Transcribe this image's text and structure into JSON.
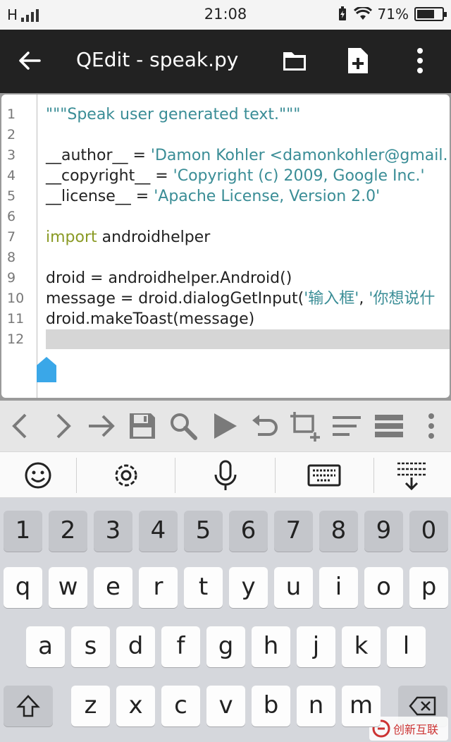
{
  "status": {
    "carrier": "H",
    "time": "21:08",
    "battery": "71%",
    "battery_level": 0.71
  },
  "appbar": {
    "title": "QEdit - speak.py",
    "icons": [
      "back-arrow-icon",
      "folder-icon",
      "new-file-icon",
      "overflow-menu-icon"
    ]
  },
  "editor": {
    "lines": [
      {
        "n": "1",
        "parts": [
          {
            "t": "\"\"\"Speak user generated text.\"\"\"",
            "c": "str"
          }
        ]
      },
      {
        "n": "2",
        "parts": []
      },
      {
        "n": "3",
        "parts": [
          {
            "t": "__author__ = ",
            "c": ""
          },
          {
            "t": "'Damon Kohler <damonkohler@gmail.",
            "c": "str"
          }
        ]
      },
      {
        "n": "4",
        "parts": [
          {
            "t": "__copyright__ = ",
            "c": ""
          },
          {
            "t": "'Copyright (c) 2009, Google Inc.'",
            "c": "str"
          }
        ]
      },
      {
        "n": "5",
        "parts": [
          {
            "t": "__license__ = ",
            "c": ""
          },
          {
            "t": "'Apache License, Version 2.0'",
            "c": "str"
          }
        ]
      },
      {
        "n": "6",
        "parts": []
      },
      {
        "n": "7",
        "parts": [
          {
            "t": "import",
            "c": "kw"
          },
          {
            "t": " androidhelper",
            "c": ""
          }
        ]
      },
      {
        "n": "8",
        "parts": []
      },
      {
        "n": "9",
        "parts": [
          {
            "t": "droid = androidhelper.Android()",
            "c": ""
          }
        ]
      },
      {
        "n": "10",
        "parts": [
          {
            "t": "message = droid.dialogGetInput(",
            "c": ""
          },
          {
            "t": "'输入框'",
            "c": "str"
          },
          {
            "t": ", ",
            "c": ""
          },
          {
            "t": "'你想说什",
            "c": "str"
          }
        ]
      },
      {
        "n": "11",
        "parts": [
          {
            "t": "droid.makeToast(message)",
            "c": ""
          }
        ]
      },
      {
        "n": "12",
        "parts": []
      }
    ],
    "current_line": "12"
  },
  "toolbar": {
    "icons": [
      "chevron-left-icon",
      "chevron-right-icon",
      "arrow-right-icon",
      "save-icon",
      "search-icon",
      "run-icon",
      "undo-icon",
      "add-snippet-icon",
      "format-icon",
      "list-icon",
      "more-icon"
    ]
  },
  "keyboard_top": {
    "icons": [
      "emoji-icon",
      "settings-icon",
      "microphone-icon",
      "keyboard-icon",
      "hide-keyboard-icon"
    ]
  },
  "keyboard": {
    "row_numbers": [
      "1",
      "2",
      "3",
      "4",
      "5",
      "6",
      "7",
      "8",
      "9",
      "0"
    ],
    "row1": [
      "q",
      "w",
      "e",
      "r",
      "t",
      "y",
      "u",
      "i",
      "o",
      "p"
    ],
    "row2": [
      "a",
      "s",
      "d",
      "f",
      "g",
      "h",
      "j",
      "k",
      "l"
    ],
    "row3": [
      "z",
      "x",
      "c",
      "v",
      "b",
      "n",
      "m"
    ]
  },
  "watermark": {
    "text": "创新互联"
  }
}
